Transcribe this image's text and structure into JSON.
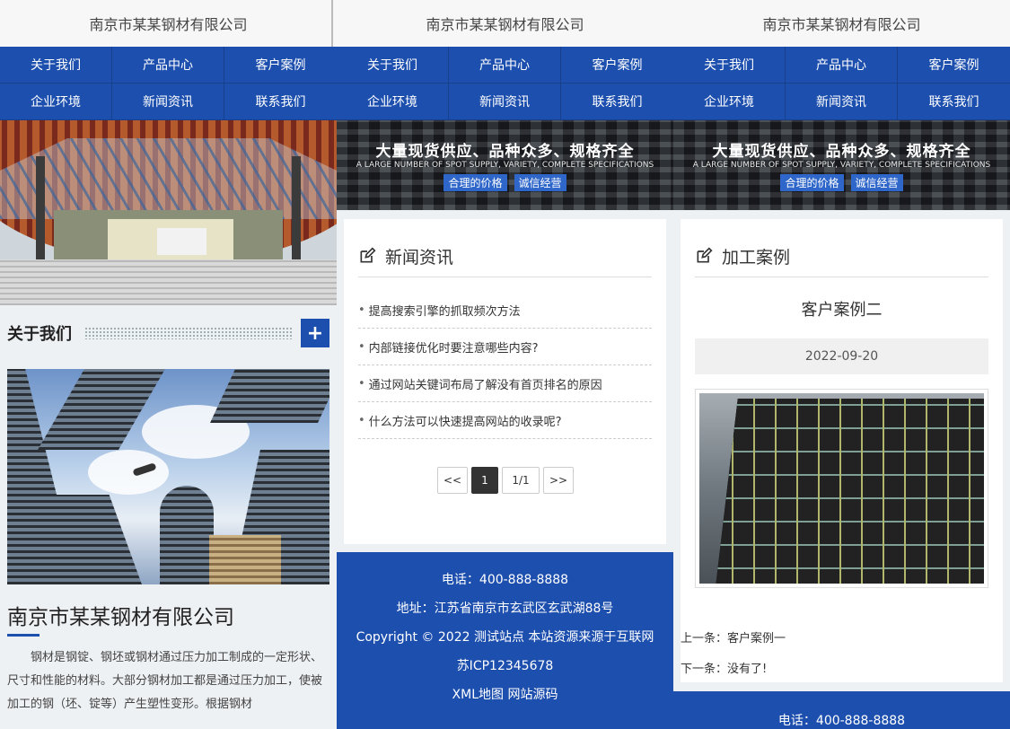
{
  "site_title": "南京市某某钢材有限公司",
  "nav": [
    {
      "label": "关于我们"
    },
    {
      "label": "产品中心"
    },
    {
      "label": "客户案例"
    },
    {
      "label": "企业环境"
    },
    {
      "label": "新闻资讯"
    },
    {
      "label": "联系我们"
    }
  ],
  "banner": {
    "title": "大量现货供应、品种众多、规格齐全",
    "subtitle": "A LARGE NUMBER OF SPOT SUPPLY, VARIETY, COMPLETE SPECIFICATIONS",
    "tag1": "合理的价格",
    "tag2": "诚信经营"
  },
  "about": {
    "title": "关于我们",
    "more_label": "+",
    "company_name": "南京市某某钢材有限公司",
    "text": "钢材是钢锭、钢坯或钢材通过压力加工制成的一定形状、尺寸和性能的材料。大部分钢材加工都是通过压力加工，使被加工的钢（坯、锭等）产生塑性变形。根据钢材"
  },
  "news": {
    "title": "新闻资讯",
    "items": [
      "提高搜索引擎的抓取频次方法",
      "内部链接优化时要注意哪些内容?",
      "通过网站关键词布局了解没有首页排名的原因",
      "什么方法可以快速提高网站的收录呢?"
    ],
    "pager": {
      "prev": "<<",
      "current": "1",
      "total": "1/1",
      "next": ">>"
    }
  },
  "case": {
    "title": "加工案例",
    "name": "客户案例二",
    "date": "2022-09-20",
    "prev": "上一条：客户案例一",
    "next": "下一条：没有了!"
  },
  "footer": {
    "phone": "电话：400-888-8888",
    "address": "地址：江苏省南京市玄武区玄武湖88号",
    "copyright": "Copyright © 2022 测试站点 本站资源来源于互联网",
    "icp": "苏ICP12345678",
    "links": "XML地图 网站源码"
  },
  "colors": {
    "brand_blue": "#1d4fae"
  }
}
